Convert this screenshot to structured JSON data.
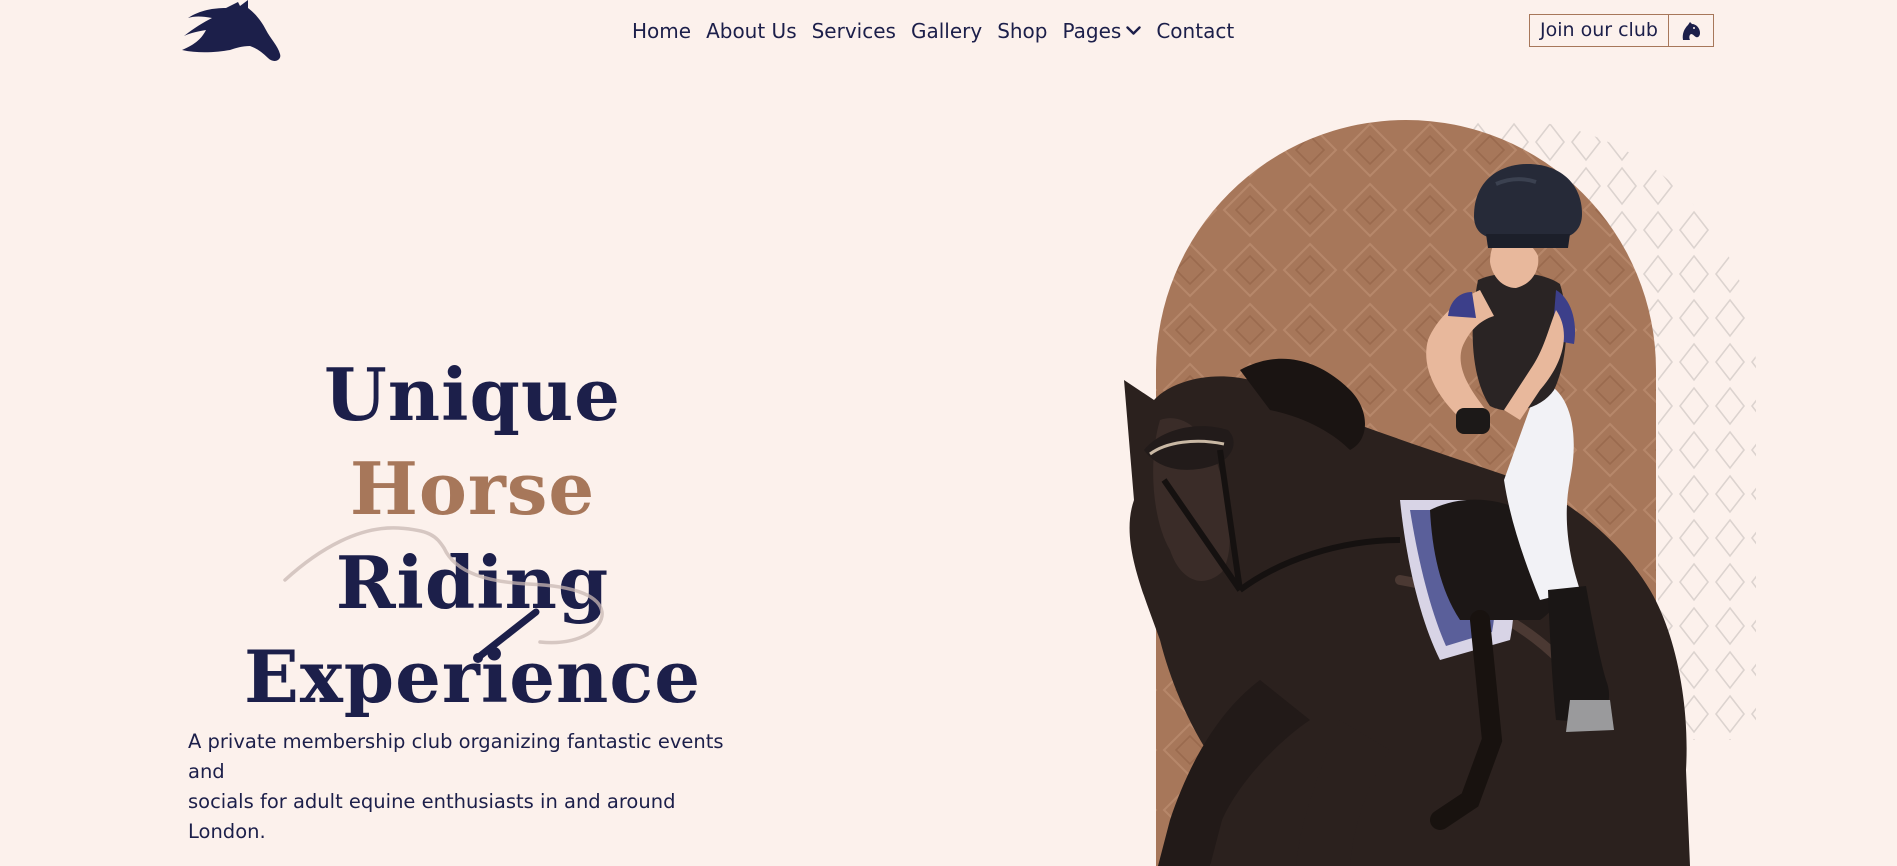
{
  "header": {
    "logo_icon": "horse-head-icon",
    "nav": [
      {
        "label": "Home"
      },
      {
        "label": "About Us"
      },
      {
        "label": "Services"
      },
      {
        "label": "Gallery"
      },
      {
        "label": "Shop"
      },
      {
        "label": "Pages",
        "icon": "chevron-down-icon"
      },
      {
        "label": "Contact"
      }
    ],
    "cta": {
      "label": "Join our club",
      "icon": "horse-head-icon"
    }
  },
  "hero": {
    "title_lines": [
      "Unique",
      "Horse",
      "Riding",
      "Experience"
    ],
    "description_lines": [
      "A private membership club organizing fantastic events and",
      "socials for adult equine enthusiasts in and around London."
    ],
    "image": "rider-on-jumping-horse"
  },
  "colors": {
    "background": "#fcf1ec",
    "navy": "#1c1f4a",
    "accent": "#a7775a"
  }
}
